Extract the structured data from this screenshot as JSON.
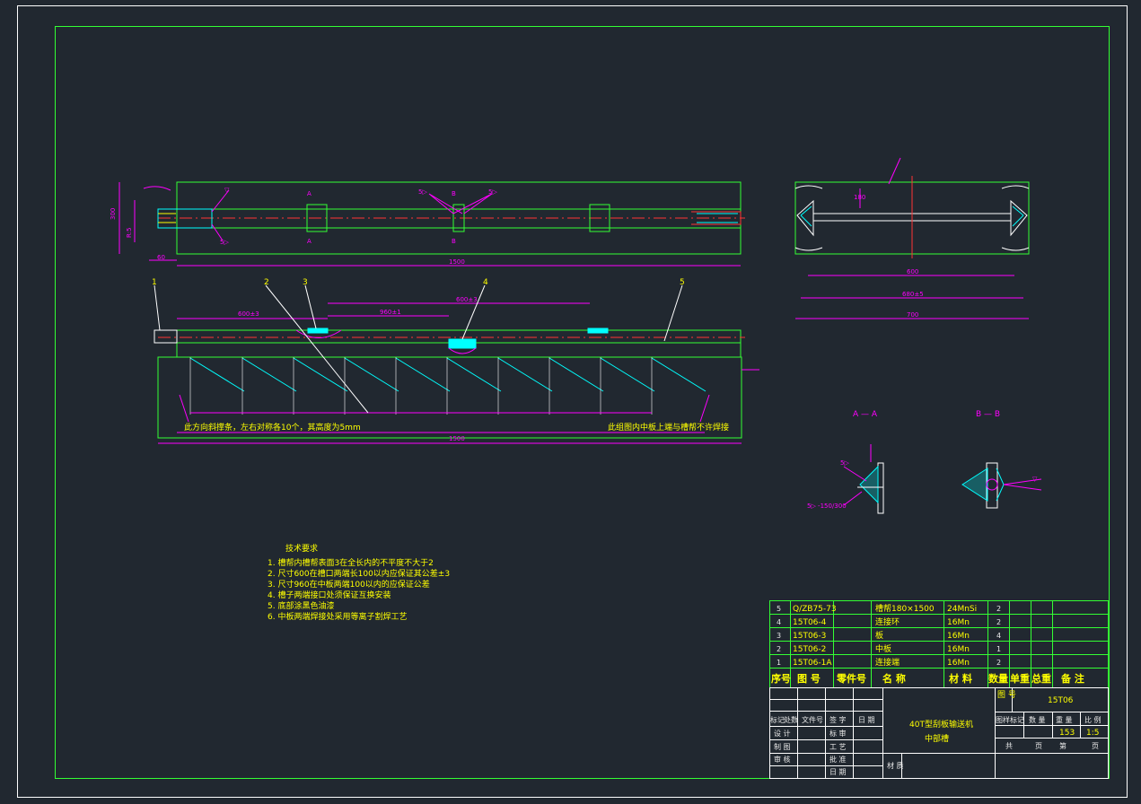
{
  "colors": {
    "background": "#212830",
    "border": "#33ff33",
    "outline": "#ffffff",
    "dimension": "#ff00ff",
    "text": "#ffff00",
    "center_line": "#ff3333",
    "cyan": "#00ffff"
  },
  "views": {
    "section_a_label": "A — A",
    "section_b_label": "B — B",
    "cut_label_a": "A",
    "cut_label_b": "B",
    "weld_note": "5▷ -150/300",
    "note_left": "此方向斜撑条，左右对称各10个，其高度为5mm",
    "note_right": "此组图内中板上端与槽帮不许焊接",
    "balloons": [
      "1",
      "2",
      "3",
      "4",
      "5"
    ]
  },
  "tech_req": {
    "title": "技术要求",
    "items": [
      "1. 槽帮内槽帮表面3在全长内的不平度不大于2",
      "2. 尺寸600在槽口两端长100以内应保证其公差±3",
      "3. 尺寸960在中板两端100以内的应保证公差",
      "4. 槽子两端接口处须保证互换安装",
      "5. 底部涂黑色油漆",
      "6. 中板两端焊接处采用等离子割焊工艺"
    ]
  },
  "parts_list": {
    "rows": [
      {
        "seq": "5",
        "code": "Q/ZB75-73",
        "part": "",
        "name": "槽帮180×1500",
        "material": "24MnSi",
        "qty": "2"
      },
      {
        "seq": "4",
        "code": "15T06-4",
        "part": "",
        "name": "连接环",
        "material": "16Mn",
        "qty": "2"
      },
      {
        "seq": "3",
        "code": "15T06-3",
        "part": "",
        "name": "板",
        "material": "16Mn",
        "qty": "4"
      },
      {
        "seq": "2",
        "code": "15T06-2",
        "part": "",
        "name": "中板",
        "material": "16Mn",
        "qty": "1"
      },
      {
        "seq": "1",
        "code": "15T06-1A",
        "part": "",
        "name": "连接端",
        "material": "16Mn",
        "qty": "2"
      }
    ],
    "headers": {
      "seq": "序号",
      "code": "图 号",
      "part": "零件号",
      "name": "名    称",
      "material": "材  料",
      "qty": "数量",
      "unit_weight": "单重",
      "total_weight": "总重",
      "remark": "备  注"
    }
  },
  "title_block": {
    "drawing_no_label": "图 号",
    "drawing_no": "15T06",
    "product_name": "40T型刮板输送机",
    "part_name": "中部槽",
    "labels": {
      "mark": "标记",
      "count": "处数",
      "file_no": "文件号",
      "signature": "签 字",
      "date": "日 期",
      "design": "设  计",
      "standard": "标  审",
      "draw": "制  图",
      "process": "工  艺",
      "check": "审  核",
      "approve": "批  准",
      "date2": "日  期",
      "material": "材  质",
      "stage": "图样标记",
      "qty": "数  量",
      "weight": "重  量",
      "scale": "比 例",
      "total": "共",
      "sheets": "页",
      "page": "第",
      "page_end": "页"
    },
    "weight": "153",
    "scale": "1:5"
  }
}
